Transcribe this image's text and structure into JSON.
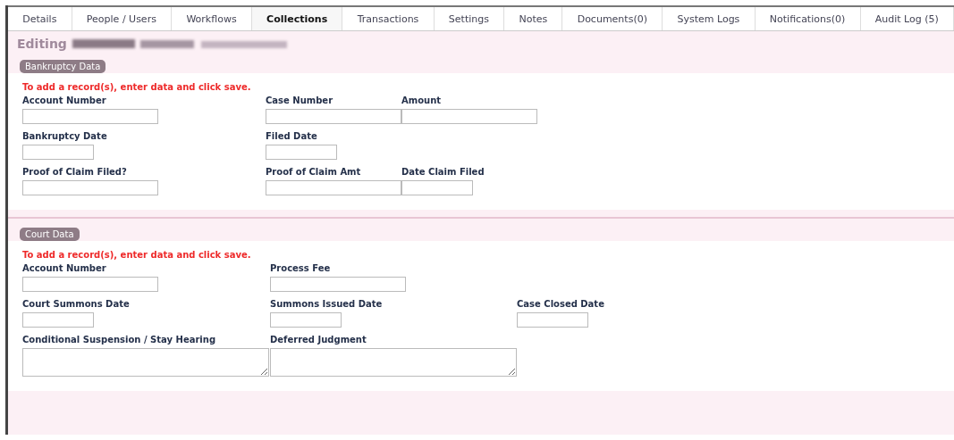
{
  "tabs": [
    {
      "label": "Details",
      "selected": false
    },
    {
      "label": "People / Users",
      "selected": false
    },
    {
      "label": "Workflows",
      "selected": false
    },
    {
      "label": "Collections",
      "selected": true
    },
    {
      "label": "Transactions",
      "selected": false
    },
    {
      "label": "Settings",
      "selected": false
    },
    {
      "label": "Notes",
      "selected": false
    },
    {
      "label": "Documents(0)",
      "selected": false
    },
    {
      "label": "System Logs",
      "selected": false
    },
    {
      "label": "Notifications(0)",
      "selected": false
    },
    {
      "label": "Audit Log (5)",
      "selected": false
    }
  ],
  "heading": {
    "title": "Editing"
  },
  "sections": [
    {
      "title": "Bankruptcy Data",
      "hint": "To add a record(s), enter data and click save.",
      "rows": [
        [
          {
            "label": "Account Number",
            "kind": "text"
          },
          {
            "label": "Case Number",
            "kind": "text"
          },
          {
            "label": "Amount",
            "kind": "text"
          }
        ],
        [
          {
            "label": "Bankruptcy Date",
            "kind": "date"
          },
          {
            "label": "Filed Date",
            "kind": "date"
          }
        ],
        [
          {
            "label": "Proof of Claim Filed?",
            "kind": "text"
          },
          {
            "label": "Proof of Claim Amt",
            "kind": "text"
          },
          {
            "label": "Date Claim Filed",
            "kind": "date"
          }
        ]
      ]
    },
    {
      "title": "Court Data",
      "hint": "To add a record(s), enter data and click save.",
      "rows": [
        [
          {
            "label": "Account Number",
            "kind": "text"
          },
          {
            "label": "Process Fee",
            "kind": "text"
          }
        ],
        [
          {
            "label": "Court Summons Date",
            "kind": "date"
          },
          {
            "label": "Summons Issued Date",
            "kind": "date"
          },
          {
            "label": "Case Closed Date",
            "kind": "date"
          }
        ],
        [
          {
            "label": "Conditional Suspension / Stay Hearing",
            "kind": "area"
          },
          {
            "label": "Deferred Judgment",
            "kind": "area"
          }
        ]
      ]
    }
  ]
}
